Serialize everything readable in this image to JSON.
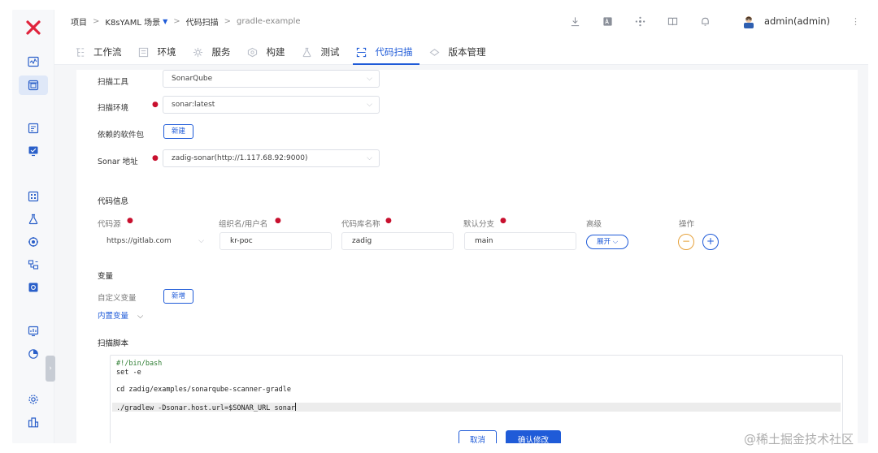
{
  "breadcrumb": {
    "items": [
      "项目",
      "K8sYAML 场景",
      "代码扫描",
      "gradle-example"
    ]
  },
  "user": {
    "name": "admin(admin)"
  },
  "tabs": [
    {
      "label": "工作流",
      "icon": "workflow-icon"
    },
    {
      "label": "环境",
      "icon": "environment-icon"
    },
    {
      "label": "服务",
      "icon": "service-icon"
    },
    {
      "label": "构建",
      "icon": "build-icon"
    },
    {
      "label": "测试",
      "icon": "test-icon"
    },
    {
      "label": "代码扫描",
      "icon": "scan-icon",
      "active": true
    },
    {
      "label": "版本管理",
      "icon": "version-icon"
    }
  ],
  "form": {
    "scan_tool": {
      "label": "扫描工具",
      "value": "SonarQube"
    },
    "scan_env": {
      "label": "扫描环境",
      "value": "sonar:latest"
    },
    "dependencies": {
      "label": "依赖的软件包",
      "button": "新建"
    },
    "sonar_address": {
      "label": "Sonar 地址",
      "value": "zadig-sonar(http://1.117.68.92:9000)"
    }
  },
  "code_info": {
    "title": "代码信息",
    "columns": [
      "代码源",
      "组织名/用户名",
      "代码库名称",
      "默认分支",
      "高级",
      "操作"
    ],
    "row": {
      "source": "https://gitlab.com",
      "org": "kr-poc",
      "repo": "zadig",
      "branch": "main",
      "advanced": "展开"
    }
  },
  "variables": {
    "title": "变量",
    "custom_label": "自定义变量",
    "custom_button": "新增",
    "builtin_link": "内置变量"
  },
  "script": {
    "title": "扫描脚本",
    "lines": [
      "#!/bin/bash",
      "set -e",
      "",
      "cd zadig/examples/sonarqube-scanner-gradle",
      "",
      "./gradlew -Dsonar.host.url=$SONAR_URL sonar"
    ]
  },
  "actions": {
    "cancel": "取消",
    "confirm": "确认修改"
  },
  "watermark": "@稀土掘金技术社区",
  "colors": {
    "primary": "#1f5bd8",
    "required": "#c8102e",
    "logo": "#e0233c"
  }
}
